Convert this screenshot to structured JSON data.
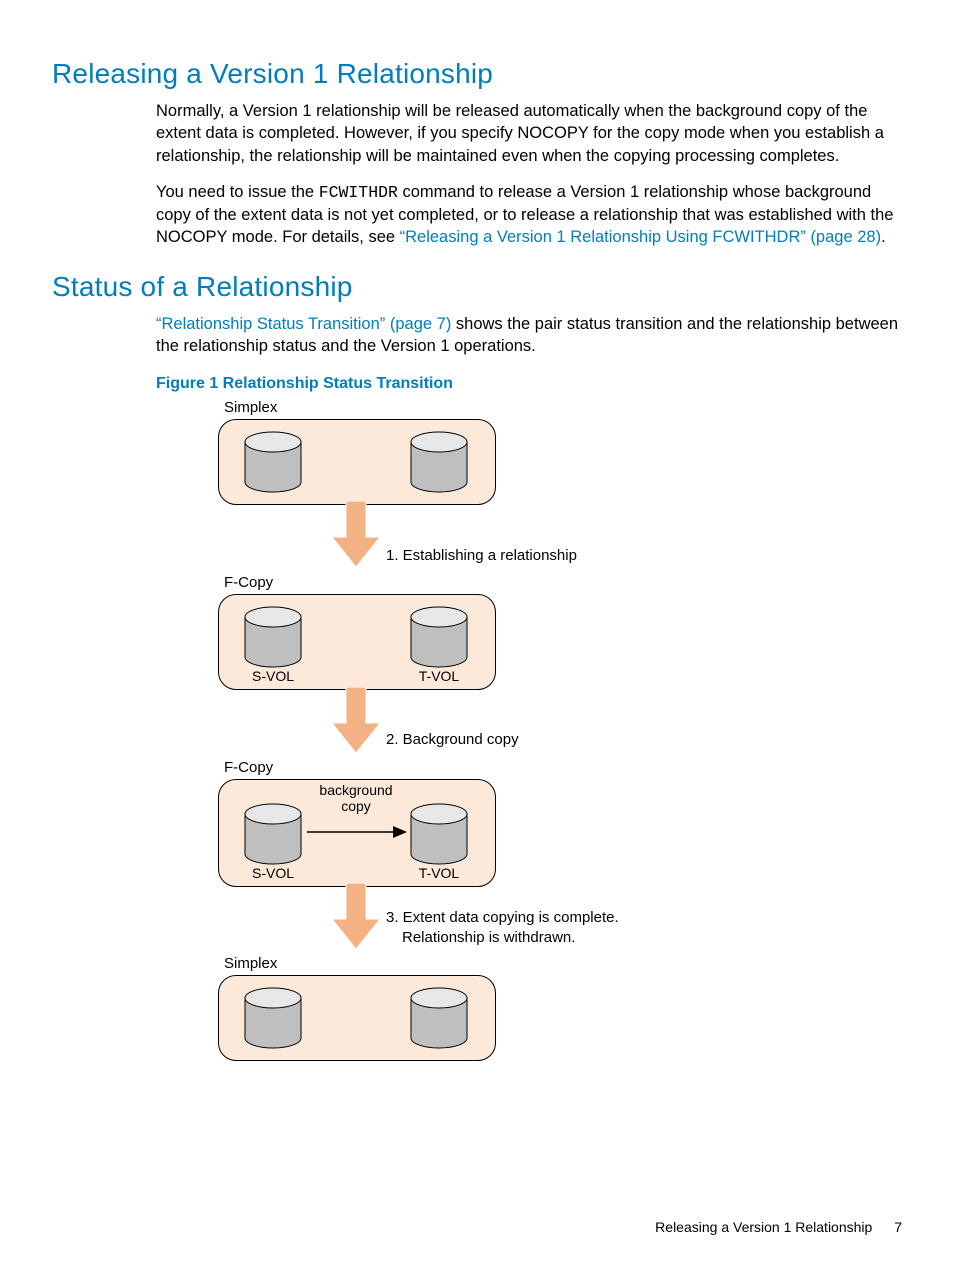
{
  "heading1": "Releasing a Version 1 Relationship",
  "para1": "Normally, a Version 1 relationship will be released automatically when the background copy of the extent data is completed. However, if you specify NOCOPY for the copy mode when you establish a relationship, the relationship will be maintained even when the copying processing completes.",
  "para2a": "You need to issue the ",
  "para2code": "FCWITHDR",
  "para2b": " command to release a Version 1 relationship whose background copy of the extent data is not yet completed, or to release a relationship that was established with the NOCOPY mode. For details, see ",
  "para2link": "“Releasing a Version 1 Relationship Using FCWITHDR” (page 28)",
  "para2c": ".",
  "heading2": "Status of a Relationship",
  "para3link": "“Relationship Status Transition” (page 7)",
  "para3": " shows the pair status transition and the relationship between the relationship status and the Version 1 operations.",
  "figcaption": "Figure 1 Relationship Status Transition",
  "diagram": {
    "state1_label": "Simplex",
    "state2_label": "F-Copy",
    "state2_svol": "S-VOL",
    "state2_tvol": "T-VOL",
    "state3_label": "F-Copy",
    "state3_svol": "S-VOL",
    "state3_tvol": "T-VOL",
    "state3_bgcopy": "background\ncopy",
    "state4_label": "Simplex",
    "step1": "1. Establishing a relationship",
    "step2": "2. Background copy",
    "step3a": "3. Extent data copying is complete.",
    "step3b": "Relationship is withdrawn."
  },
  "footer_text": "Releasing a Version 1 Relationship",
  "page_number": "7"
}
